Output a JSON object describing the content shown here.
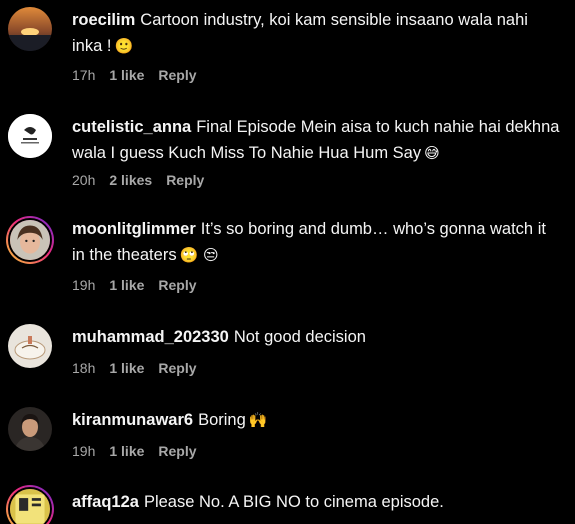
{
  "comments": [
    {
      "username": "roecilim",
      "text": "Cartoon industry, koi kam sensible insaano wala nahi inka !",
      "emoji": "🙂",
      "time": "17h",
      "likes": "1 like",
      "reply": "Reply"
    },
    {
      "username": "cutelistic_anna",
      "text": "Final Episode Mein aisa to kuch nahie hai dekhna wala I guess Kuch Miss To Nahie Hua Hum Say",
      "emoji": "😅",
      "time": "20h",
      "likes": "2 likes",
      "reply": "Reply"
    },
    {
      "username": "moonlitglimmer",
      "text": "It’s so boring and dumb… who’s gonna watch it in the theaters",
      "emoji": "🙄 😒",
      "time": "19h",
      "likes": "1 like",
      "reply": "Reply"
    },
    {
      "username": "muhammad_202330",
      "text": "Not good decision",
      "emoji": "",
      "time": "18h",
      "likes": "1 like",
      "reply": "Reply"
    },
    {
      "username": "kiranmunawar6",
      "text": "Boring",
      "emoji": "🙌",
      "time": "19h",
      "likes": "1 like",
      "reply": "Reply"
    },
    {
      "username": "affaq12a",
      "text": "Please No. A BIG NO to cinema episode.",
      "emoji": "",
      "time": "",
      "likes": "",
      "reply": ""
    }
  ]
}
